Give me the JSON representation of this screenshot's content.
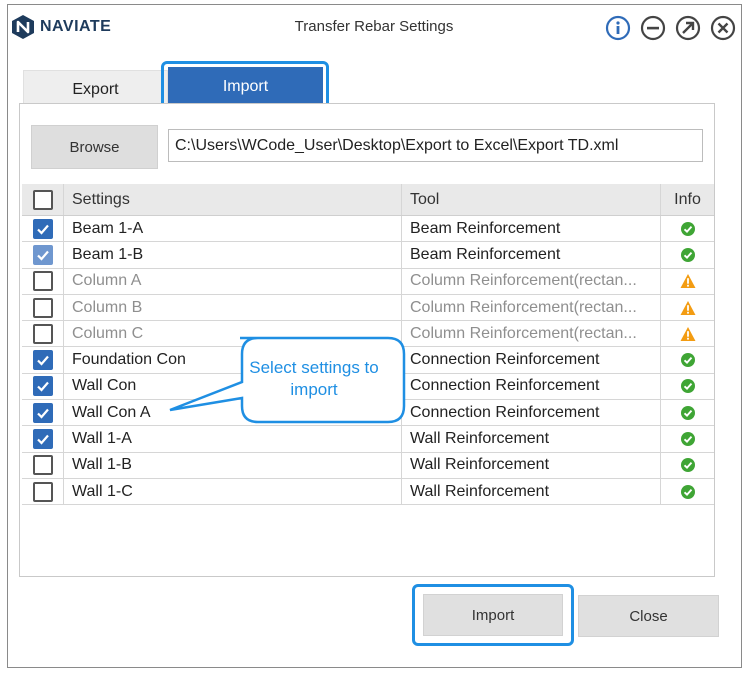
{
  "app": {
    "brand": "NAVIATE",
    "title": "Transfer Rebar Settings",
    "controls": [
      {
        "name": "info-icon"
      },
      {
        "name": "minimize-icon"
      },
      {
        "name": "restore-icon"
      },
      {
        "name": "close-icon"
      }
    ]
  },
  "tabs": {
    "export_label": "Export",
    "import_label": "Import",
    "active": "Import"
  },
  "browse": {
    "button_label": "Browse",
    "path": "C:\\Users\\WCode_User\\Desktop\\Export to Excel\\Export TD.xml"
  },
  "table": {
    "headers": {
      "settings": "Settings",
      "tool": "Tool",
      "info": "Info"
    },
    "rows": [
      {
        "setting": "Beam 1-A",
        "tool": "Beam Reinforcement",
        "checked": true,
        "status": "ok",
        "disabled": false
      },
      {
        "setting": "Beam 1-B",
        "tool": "Beam Reinforcement",
        "checked": true,
        "status": "ok",
        "disabled": false
      },
      {
        "setting": "Column A",
        "tool": "Column Reinforcement(rectan...",
        "checked": false,
        "status": "warning",
        "disabled": true
      },
      {
        "setting": "Column B",
        "tool": "Column Reinforcement(rectan...",
        "checked": false,
        "status": "warning",
        "disabled": true
      },
      {
        "setting": "Column C",
        "tool": "Column Reinforcement(rectan...",
        "checked": false,
        "status": "warning",
        "disabled": true
      },
      {
        "setting": "Foundation Con",
        "tool": "Connection Reinforcement",
        "checked": true,
        "status": "ok",
        "disabled": false
      },
      {
        "setting": "Wall Con",
        "tool": "Connection Reinforcement",
        "checked": true,
        "status": "ok",
        "disabled": false
      },
      {
        "setting": "Wall Con A",
        "tool": "Connection Reinforcement",
        "checked": true,
        "status": "ok",
        "disabled": false
      },
      {
        "setting": "Wall 1-A",
        "tool": "Wall Reinforcement",
        "checked": true,
        "status": "ok",
        "disabled": false
      },
      {
        "setting": "Wall 1-B",
        "tool": "Wall Reinforcement",
        "checked": false,
        "status": "ok",
        "disabled": false
      },
      {
        "setting": "Wall 1-C",
        "tool": "Wall Reinforcement",
        "checked": false,
        "status": "ok",
        "disabled": false
      }
    ]
  },
  "callout": {
    "text": "Select settings to import"
  },
  "buttons": {
    "import_label": "Import",
    "close_label": "Close"
  },
  "colors": {
    "accent": "#2f6bb8",
    "highlight": "#1f8fe3",
    "ok": "#3fa535",
    "warning": "#f39c12",
    "brand": "#1e3b5c"
  }
}
